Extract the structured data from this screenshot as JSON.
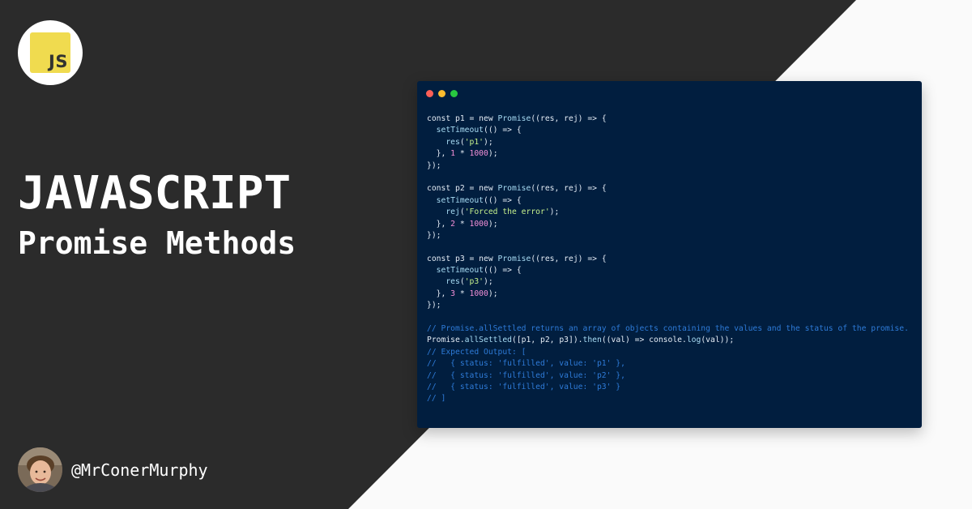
{
  "logo": {
    "text": "JS"
  },
  "title": "JAVASCRIPT",
  "subtitle": "Promise Methods",
  "author": {
    "handle": "@MrConerMurphy"
  },
  "colors": {
    "dark_panel": "#2b2b2b",
    "light_panel": "#fafafa",
    "code_bg": "#011e3f",
    "js_yellow": "#f0db4f",
    "dot_red": "#fe5f57",
    "dot_yellow": "#febc2e",
    "dot_green": "#28c840",
    "comment": "#2e7bd8",
    "string": "#c5f08c",
    "number": "#f48fd8"
  },
  "code_lines": [
    [
      {
        "t": "const p1 = new ",
        "c": "kw"
      },
      {
        "t": "Promise",
        "c": "fn"
      },
      {
        "t": "((res, rej) => {",
        "c": "plain"
      }
    ],
    [
      {
        "t": "  ",
        "c": "plain"
      },
      {
        "t": "setTimeout",
        "c": "fn"
      },
      {
        "t": "(() => {",
        "c": "plain"
      }
    ],
    [
      {
        "t": "    ",
        "c": "plain"
      },
      {
        "t": "res",
        "c": "fn"
      },
      {
        "t": "(",
        "c": "plain"
      },
      {
        "t": "'p1'",
        "c": "str"
      },
      {
        "t": ");",
        "c": "plain"
      }
    ],
    [
      {
        "t": "  }, ",
        "c": "plain"
      },
      {
        "t": "1",
        "c": "num"
      },
      {
        "t": " * ",
        "c": "plain"
      },
      {
        "t": "1000",
        "c": "num"
      },
      {
        "t": ");",
        "c": "plain"
      }
    ],
    [
      {
        "t": "});",
        "c": "plain"
      }
    ],
    [
      {
        "t": "",
        "c": "plain"
      }
    ],
    [
      {
        "t": "const p2 = new ",
        "c": "kw"
      },
      {
        "t": "Promise",
        "c": "fn"
      },
      {
        "t": "((res, rej) => {",
        "c": "plain"
      }
    ],
    [
      {
        "t": "  ",
        "c": "plain"
      },
      {
        "t": "setTimeout",
        "c": "fn"
      },
      {
        "t": "(() => {",
        "c": "plain"
      }
    ],
    [
      {
        "t": "    ",
        "c": "plain"
      },
      {
        "t": "rej",
        "c": "fn"
      },
      {
        "t": "(",
        "c": "plain"
      },
      {
        "t": "'Forced the error'",
        "c": "str"
      },
      {
        "t": ");",
        "c": "plain"
      }
    ],
    [
      {
        "t": "  }, ",
        "c": "plain"
      },
      {
        "t": "2",
        "c": "num"
      },
      {
        "t": " * ",
        "c": "plain"
      },
      {
        "t": "1000",
        "c": "num"
      },
      {
        "t": ");",
        "c": "plain"
      }
    ],
    [
      {
        "t": "});",
        "c": "plain"
      }
    ],
    [
      {
        "t": "",
        "c": "plain"
      }
    ],
    [
      {
        "t": "const p3 = new ",
        "c": "kw"
      },
      {
        "t": "Promise",
        "c": "fn"
      },
      {
        "t": "((res, rej) => {",
        "c": "plain"
      }
    ],
    [
      {
        "t": "  ",
        "c": "plain"
      },
      {
        "t": "setTimeout",
        "c": "fn"
      },
      {
        "t": "(() => {",
        "c": "plain"
      }
    ],
    [
      {
        "t": "    ",
        "c": "plain"
      },
      {
        "t": "res",
        "c": "fn"
      },
      {
        "t": "(",
        "c": "plain"
      },
      {
        "t": "'p3'",
        "c": "str"
      },
      {
        "t": ");",
        "c": "plain"
      }
    ],
    [
      {
        "t": "  }, ",
        "c": "plain"
      },
      {
        "t": "3",
        "c": "num"
      },
      {
        "t": " * ",
        "c": "plain"
      },
      {
        "t": "1000",
        "c": "num"
      },
      {
        "t": ");",
        "c": "plain"
      }
    ],
    [
      {
        "t": "});",
        "c": "plain"
      }
    ],
    [
      {
        "t": "",
        "c": "plain"
      }
    ],
    [
      {
        "t": "// Promise.allSettled returns an array of objects containing the values and the status of the promise.",
        "c": "com"
      }
    ],
    [
      {
        "t": "Promise.",
        "c": "plain"
      },
      {
        "t": "allSettled",
        "c": "fn"
      },
      {
        "t": "([p1, p2, p3]).",
        "c": "plain"
      },
      {
        "t": "then",
        "c": "fn"
      },
      {
        "t": "((val) => console.",
        "c": "plain"
      },
      {
        "t": "log",
        "c": "fn"
      },
      {
        "t": "(val));",
        "c": "plain"
      }
    ],
    [
      {
        "t": "// Expected Output: [",
        "c": "com"
      }
    ],
    [
      {
        "t": "//   { status: 'fulfilled', value: 'p1' },",
        "c": "com"
      }
    ],
    [
      {
        "t": "//   { status: 'fulfilled', value: 'p2' },",
        "c": "com"
      }
    ],
    [
      {
        "t": "//   { status: 'fulfilled', value: 'p3' }",
        "c": "com"
      }
    ],
    [
      {
        "t": "// ]",
        "c": "com"
      }
    ]
  ]
}
